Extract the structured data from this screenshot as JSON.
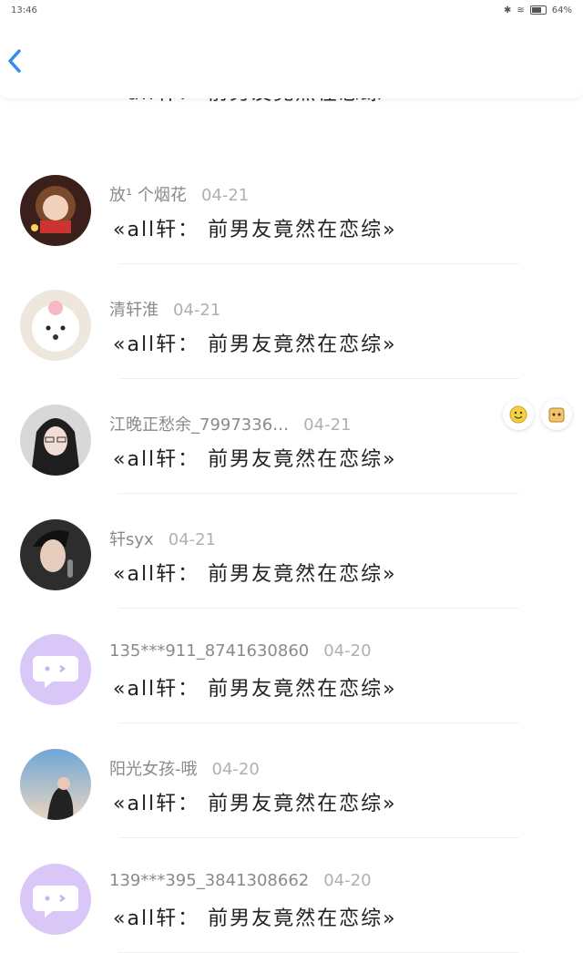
{
  "status": {
    "time": "13:46",
    "battery": "64%"
  },
  "nav": {
    "back_icon": "chevron-left-icon"
  },
  "comments": [
    {
      "name": "",
      "date": "",
      "text": "«all轩： 前男友竟然在恋综»",
      "avatar": "default-chat-bubble"
    },
    {
      "name": "放¹ 个烟花",
      "date": "04-21",
      "text": "«all轩： 前男友竟然在恋综»",
      "avatar": "illustrated-girl"
    },
    {
      "name": "清轩淮",
      "date": "04-21",
      "text": "«all轩： 前男友竟然在恋综»",
      "avatar": "white-dog"
    },
    {
      "name": "江晚正愁余_7997336…",
      "date": "04-21",
      "text": "«all轩： 前男友竟然在恋综»",
      "avatar": "girl-photo"
    },
    {
      "name": "轩syx",
      "date": "04-21",
      "text": "«all轩： 前男友竟然在恋综»",
      "avatar": "singer-photo"
    },
    {
      "name": "135***911_8741630860",
      "date": "04-20",
      "text": "«all轩： 前男友竟然在恋综»",
      "avatar": "default-chat-bubble"
    },
    {
      "name": "阳光女孩-哦",
      "date": "04-20",
      "text": "«all轩： 前男友竟然在恋综»",
      "avatar": "sky-photo"
    },
    {
      "name": "139***395_3841308662",
      "date": "04-20",
      "text": "«all轩： 前男友竟然在恋综»",
      "avatar": "default-chat-bubble"
    }
  ],
  "colors": {
    "accent": "#2f8cf0",
    "default_avatar": "#d9c8f7"
  }
}
